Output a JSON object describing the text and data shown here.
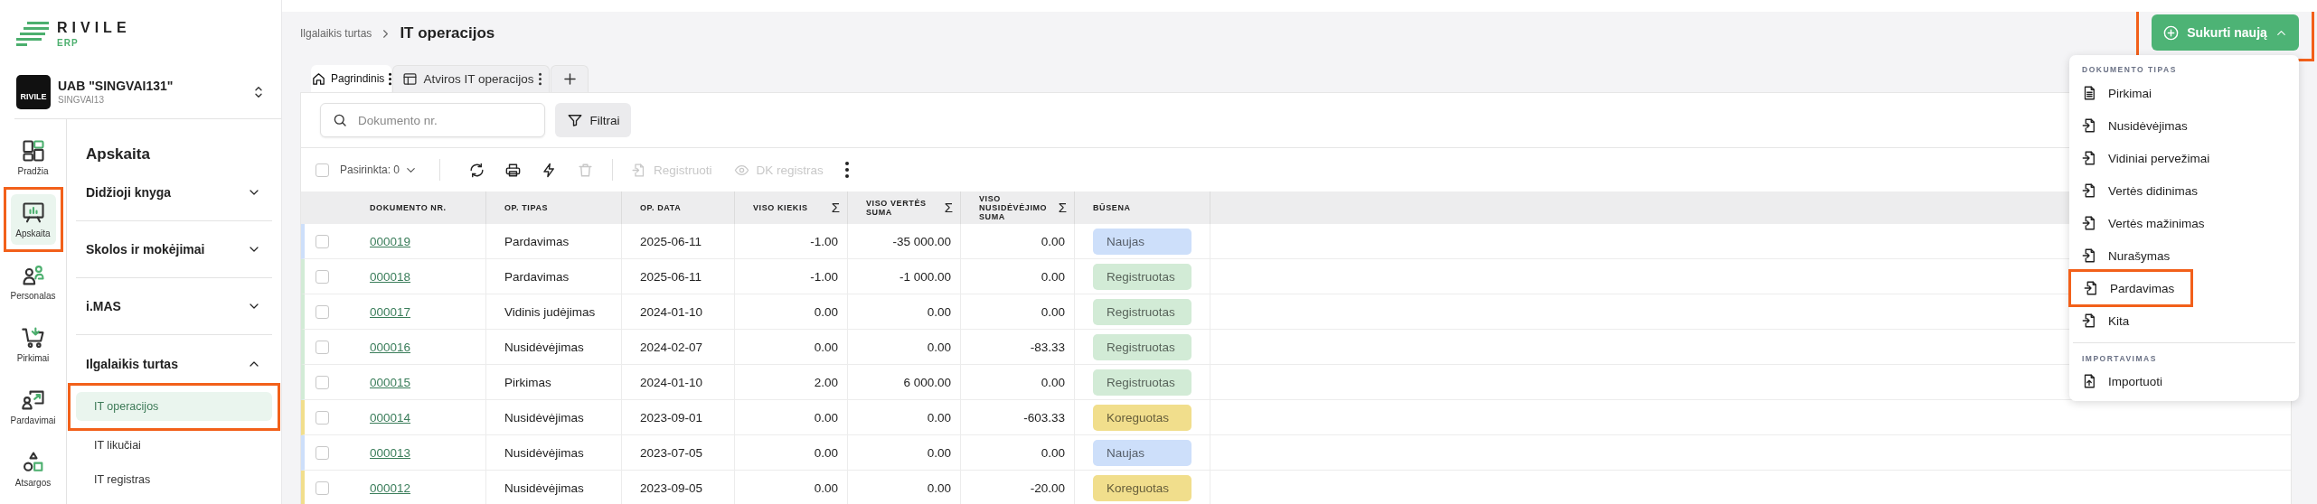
{
  "logo": {
    "name": "RIVILE",
    "sub": "ERP"
  },
  "company": {
    "avatar_label": "RIVILE",
    "name": "UAB \"SINGVAI131\"",
    "code": "SINGVAI13"
  },
  "rail": [
    {
      "label": "Pradžia",
      "selected": false,
      "highlighted": false
    },
    {
      "label": "Apskaita",
      "selected": true,
      "highlighted": true
    },
    {
      "label": "Personalas",
      "selected": false,
      "highlighted": false
    },
    {
      "label": "Pirkimai",
      "selected": false,
      "highlighted": false
    },
    {
      "label": "Pardavimai",
      "selected": false,
      "highlighted": false
    },
    {
      "label": "Atsargos",
      "selected": false,
      "highlighted": false
    }
  ],
  "nav": {
    "title": "Apskaita",
    "sections": [
      {
        "label": "Didžioji knyga",
        "expanded": false
      },
      {
        "label": "Skolos ir mokėjimai",
        "expanded": false
      },
      {
        "label": "i.MAS",
        "expanded": false
      },
      {
        "label": "Ilgalaikis turtas",
        "expanded": true,
        "children": [
          {
            "label": "IT operacijos",
            "selected": true,
            "highlighted": true
          },
          {
            "label": "IT likučiai",
            "selected": false,
            "highlighted": false
          },
          {
            "label": "IT registras",
            "selected": false,
            "highlighted": false
          }
        ]
      }
    ]
  },
  "breadcrumb": [
    "Ilgalaikis turtas"
  ],
  "page_title": "IT operacijos",
  "create_button": {
    "label": "Sukurti naują",
    "expanded": true,
    "highlighted": true
  },
  "create_menu": {
    "groups": [
      {
        "title": "DOKUMENTO TIPAS",
        "items": [
          {
            "label": "Pirkimai",
            "highlighted": false
          },
          {
            "label": "Nusidėvėjimas",
            "highlighted": false
          },
          {
            "label": "Vidiniai pervežimai",
            "highlighted": false
          },
          {
            "label": "Vertės didinimas",
            "highlighted": false
          },
          {
            "label": "Vertės mažinimas",
            "highlighted": false
          },
          {
            "label": "Nurašymas",
            "highlighted": false
          },
          {
            "label": "Pardavimas",
            "highlighted": true
          },
          {
            "label": "Kita",
            "highlighted": false
          }
        ]
      },
      {
        "title": "IMPORTAVIMAS",
        "items": [
          {
            "label": "Importuoti",
            "highlighted": false
          }
        ]
      }
    ]
  },
  "view_tabs": [
    {
      "label": "Pagrindinis",
      "selected": true
    },
    {
      "label": "Atviros IT operacijos",
      "selected": false
    }
  ],
  "search": {
    "placeholder": "Dokumento nr."
  },
  "filter_button": "Filtrai",
  "selection": {
    "label": "Pasirinkta: 0",
    "checked": false
  },
  "toolbar_icons": [
    {
      "disabled": false
    },
    {
      "disabled": false
    },
    {
      "disabled": false
    },
    {
      "disabled": true
    }
  ],
  "actions": [
    {
      "label": "Registruoti",
      "disabled": true
    },
    {
      "label": "DK registras",
      "disabled": true
    }
  ],
  "table": {
    "columns": [
      {
        "label": "DOKUMENTO NR."
      },
      {
        "label": "OP. TIPAS"
      },
      {
        "label": "OP. DATA"
      },
      {
        "label": "VISO KIEKIS",
        "sum": "Σ"
      },
      {
        "label": "VISO VERTĖS SUMA",
        "sum": "Σ"
      },
      {
        "label": "VISO NUSIDĖVĖJIMO SUMA",
        "sum": "Σ"
      },
      {
        "label": "BŪSENA"
      }
    ],
    "rows": [
      {
        "checked": false,
        "cells": [
          "000019",
          "Pardavimas",
          "2025-06-11",
          "-1.00",
          "-35 000.00",
          "0.00"
        ],
        "status": {
          "label": "Naujas",
          "color": "#cddffa"
        }
      },
      {
        "checked": false,
        "cells": [
          "000018",
          "Pardavimas",
          "2025-06-11",
          "-1.00",
          "-1 000.00",
          "0.00"
        ],
        "status": {
          "label": "Registruotas",
          "color": "#d2ebd6"
        }
      },
      {
        "checked": false,
        "cells": [
          "000017",
          "Vidinis judėjimas",
          "2024-01-10",
          "0.00",
          "0.00",
          "0.00"
        ],
        "status": {
          "label": "Registruotas",
          "color": "#d2ebd6"
        }
      },
      {
        "checked": false,
        "cells": [
          "000016",
          "Nusidėvėjimas",
          "2024-02-07",
          "0.00",
          "0.00",
          "-83.33"
        ],
        "status": {
          "label": "Registruotas",
          "color": "#d2ebd6"
        }
      },
      {
        "checked": false,
        "cells": [
          "000015",
          "Pirkimas",
          "2024-01-10",
          "2.00",
          "6 000.00",
          "0.00"
        ],
        "status": {
          "label": "Registruotas",
          "color": "#d2ebd6"
        }
      },
      {
        "checked": false,
        "cells": [
          "000014",
          "Nusidėvėjimas",
          "2023-09-01",
          "0.00",
          "0.00",
          "-603.33"
        ],
        "status": {
          "label": "Koreguotas",
          "color": "#f1de8c"
        }
      },
      {
        "checked": false,
        "cells": [
          "000013",
          "Nusidėvėjimas",
          "2023-07-05",
          "0.00",
          "0.00",
          "0.00"
        ],
        "status": {
          "label": "Naujas",
          "color": "#cddffa"
        }
      },
      {
        "checked": false,
        "cells": [
          "000012",
          "Nusidėvėjimas",
          "2023-09-05",
          "0.00",
          "0.00",
          "-20.00"
        ],
        "status": {
          "label": "Koreguotas",
          "color": "#f1de8c"
        }
      }
    ]
  }
}
